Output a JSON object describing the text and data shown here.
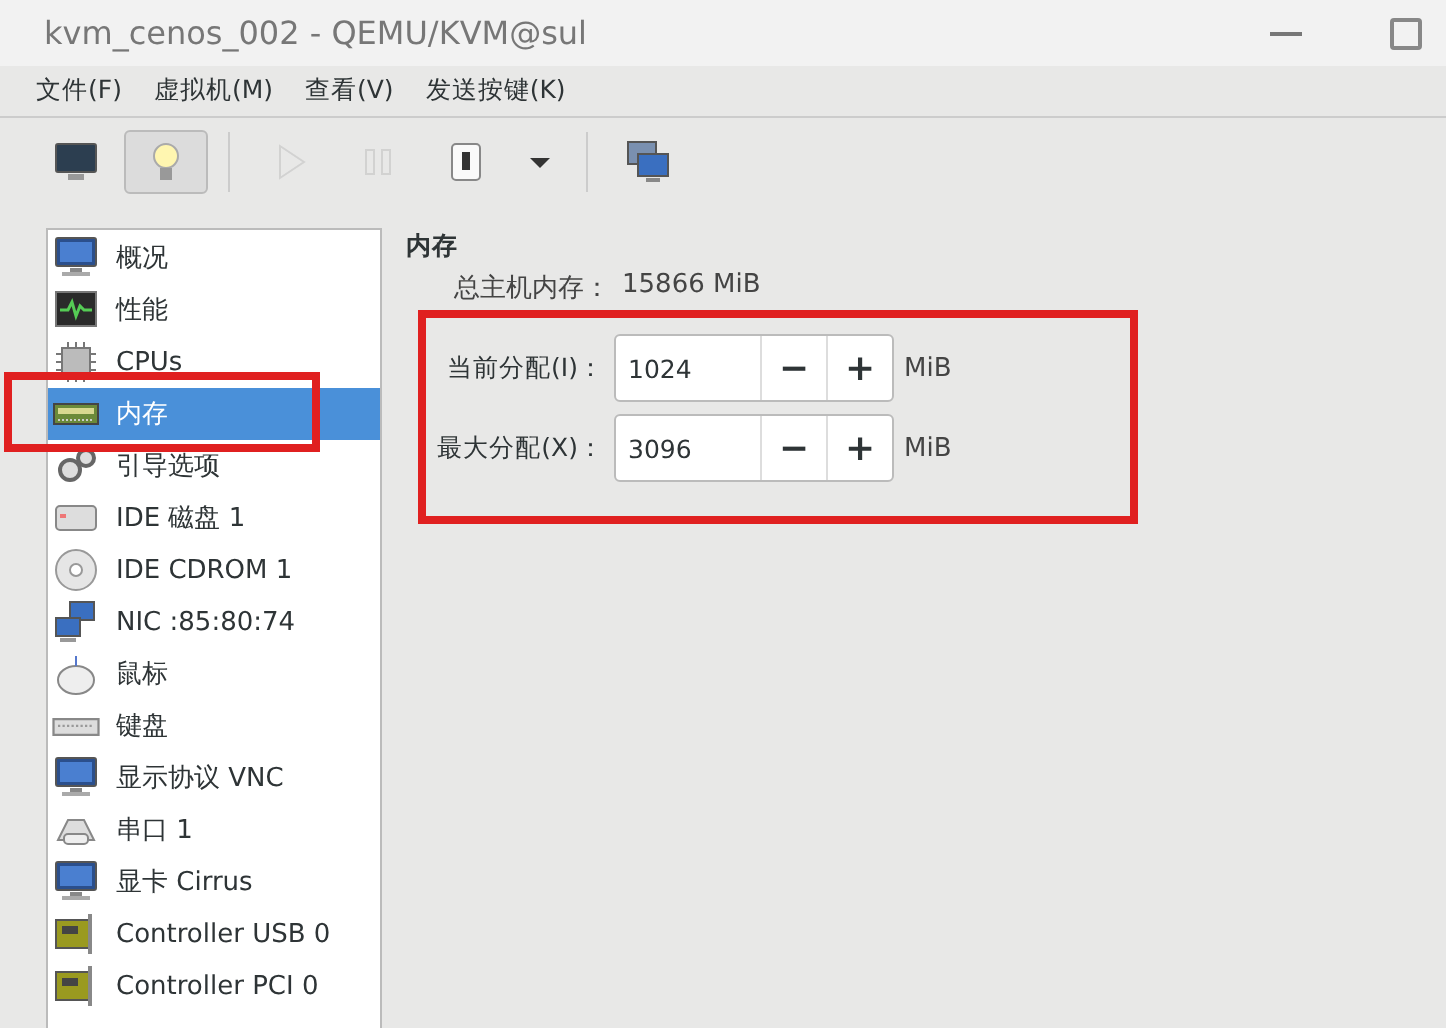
{
  "window": {
    "title": "kvm_cenos_002 - QEMU/KVM@sul"
  },
  "menu": [
    "文件(F)",
    "虚拟机(M)",
    "查看(V)",
    "发送按键(K)"
  ],
  "toolbar": [
    {
      "kind": "console",
      "selected": false,
      "disabled": false
    },
    {
      "kind": "details",
      "selected": true,
      "disabled": false
    },
    {
      "kind": "separator"
    },
    {
      "kind": "run",
      "selected": false,
      "disabled": true
    },
    {
      "kind": "pause",
      "selected": false,
      "disabled": true
    },
    {
      "kind": "power",
      "selected": false,
      "disabled": false
    },
    {
      "kind": "dropdown",
      "selected": false,
      "disabled": false
    },
    {
      "kind": "separator"
    },
    {
      "kind": "screens",
      "selected": false,
      "disabled": false
    }
  ],
  "sidebar": {
    "items": [
      {
        "label": "概况",
        "kind": "monitor",
        "selected": false
      },
      {
        "label": "性能",
        "kind": "chart",
        "selected": false
      },
      {
        "label": "CPUs",
        "kind": "chip",
        "selected": false
      },
      {
        "label": "内存",
        "kind": "ram",
        "selected": true
      },
      {
        "label": "引导选项",
        "kind": "gears",
        "selected": false
      },
      {
        "label": "IDE 磁盘 1",
        "kind": "disk",
        "selected": false
      },
      {
        "label": "IDE CDROM 1",
        "kind": "cdrom",
        "selected": false
      },
      {
        "label": "NIC :85:80:74",
        "kind": "network",
        "selected": false
      },
      {
        "label": "鼠标",
        "kind": "mouse",
        "selected": false
      },
      {
        "label": "键盘",
        "kind": "keyboard",
        "selected": false
      },
      {
        "label": "显示协议 VNC",
        "kind": "monitor",
        "selected": false
      },
      {
        "label": "串口 1",
        "kind": "serial",
        "selected": false
      },
      {
        "label": "显卡 Cirrus",
        "kind": "monitor",
        "selected": false
      },
      {
        "label": "Controller USB 0",
        "kind": "card",
        "selected": false
      },
      {
        "label": "Controller PCI 0",
        "kind": "card",
        "selected": false
      }
    ]
  },
  "memory": {
    "heading": "内存",
    "total_label": "总主机内存：",
    "total_value": "15866 MiB",
    "fields": [
      {
        "label": "当前分配(I)：",
        "value": "1024",
        "minus": "−",
        "plus": "+",
        "unit": "MiB"
      },
      {
        "label": "最大分配(X)：",
        "value": "3096",
        "minus": "−",
        "plus": "+",
        "unit": "MiB"
      }
    ]
  }
}
